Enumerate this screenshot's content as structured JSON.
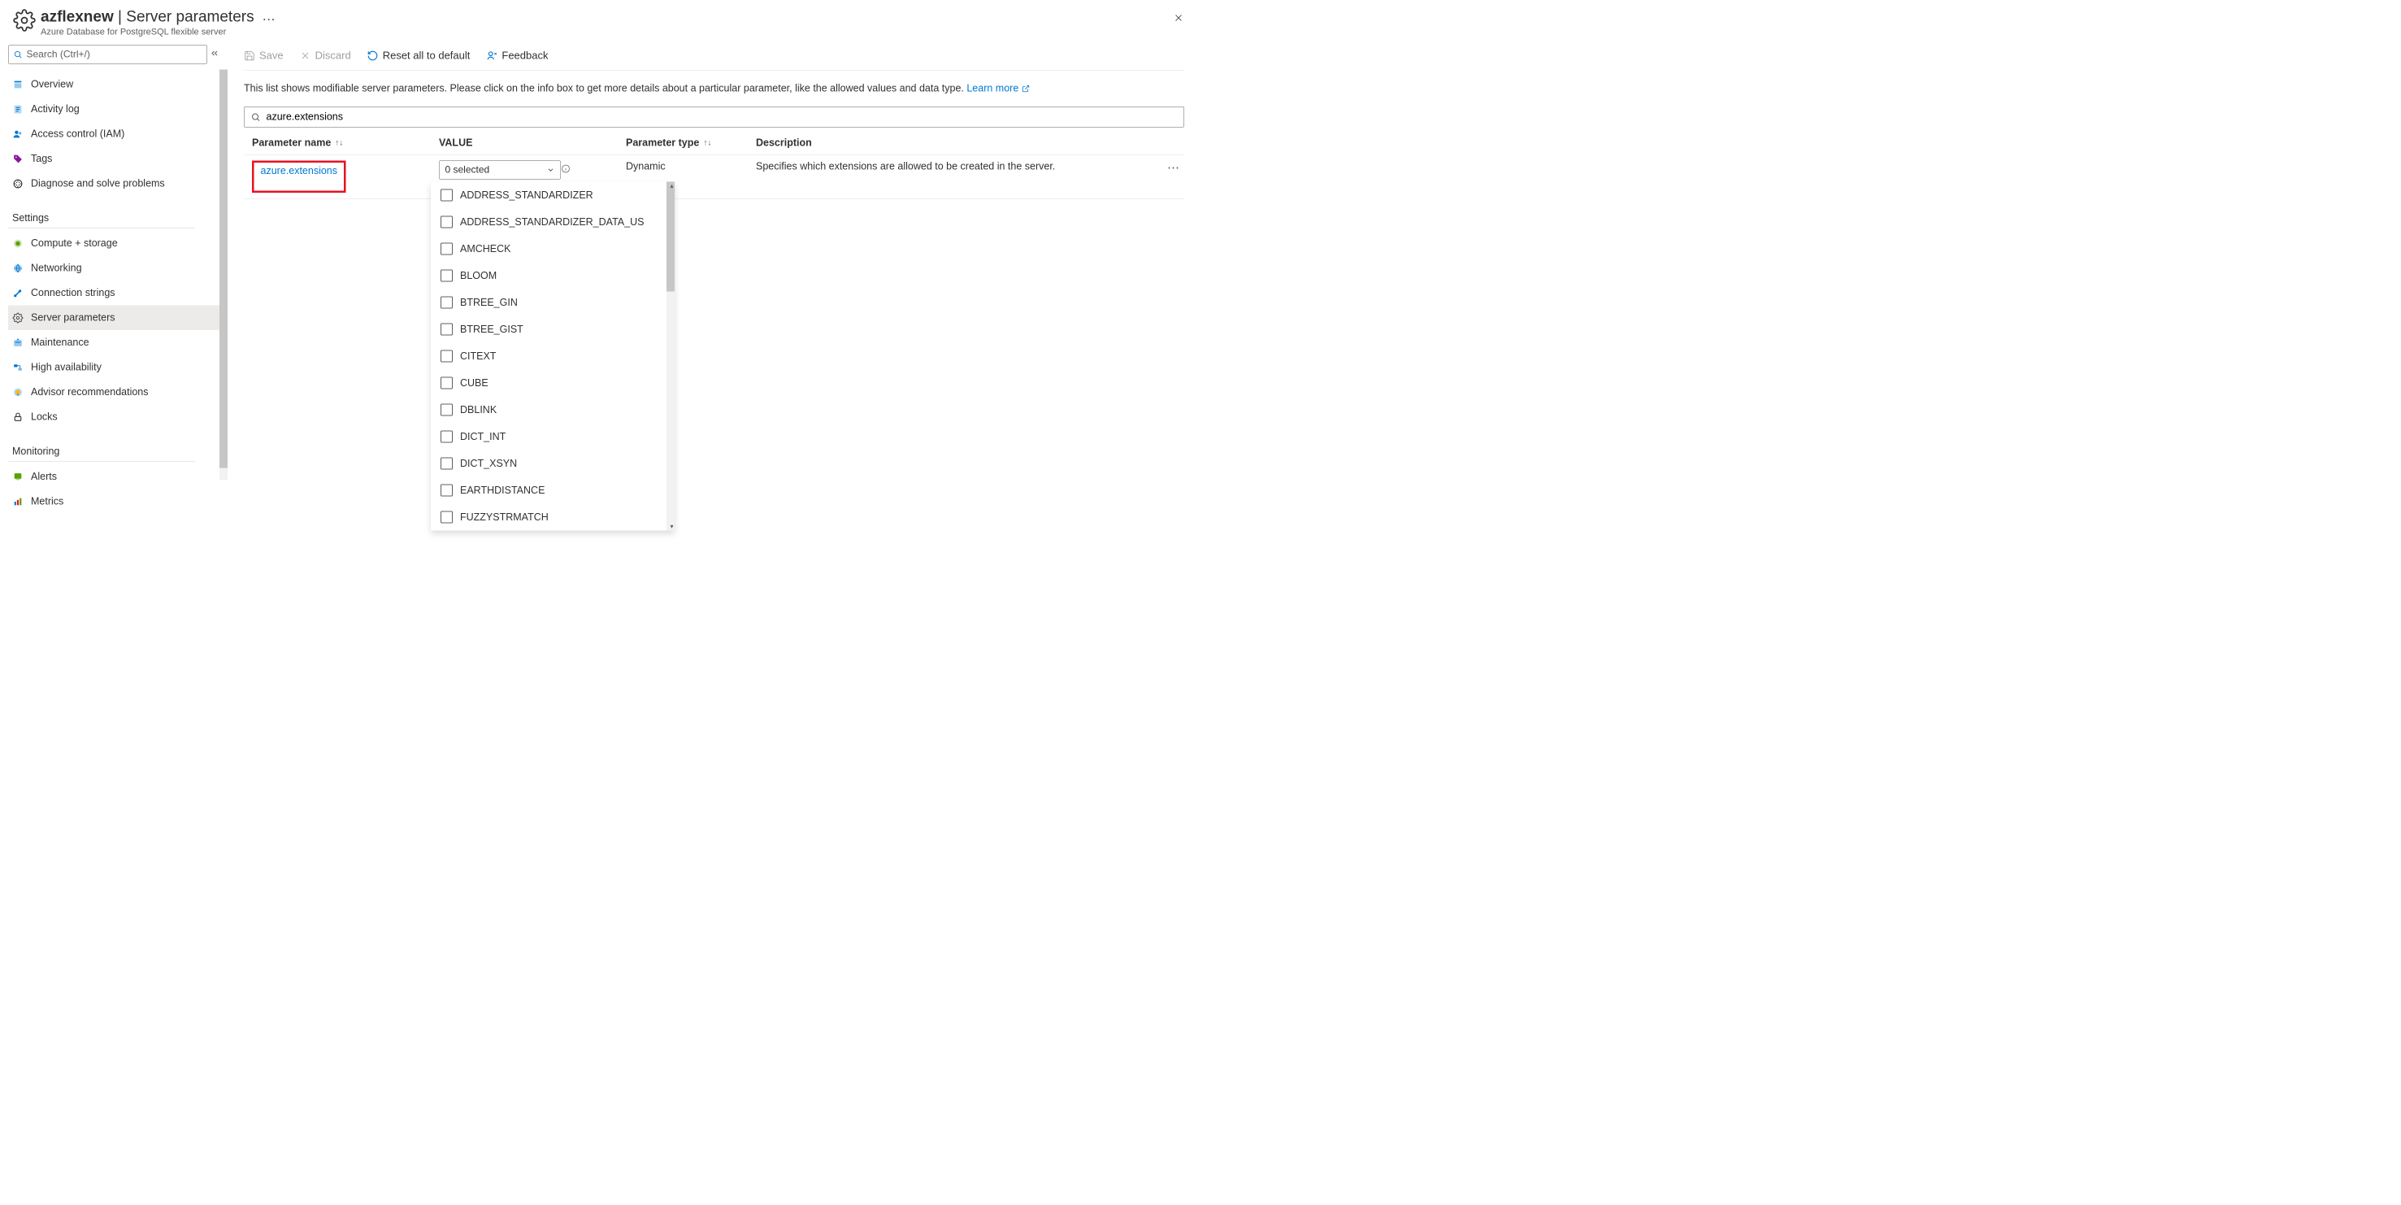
{
  "header": {
    "resource_name": "azflexnew",
    "page_title": "Server parameters",
    "subtitle": "Azure Database for PostgreSQL flexible server"
  },
  "sidebar": {
    "search_placeholder": "Search (Ctrl+/)",
    "items_top": [
      {
        "label": "Overview",
        "icon": "overview"
      },
      {
        "label": "Activity log",
        "icon": "activitylog"
      },
      {
        "label": "Access control (IAM)",
        "icon": "iam"
      },
      {
        "label": "Tags",
        "icon": "tags"
      },
      {
        "label": "Diagnose and solve problems",
        "icon": "diagnose"
      }
    ],
    "section_settings": "Settings",
    "items_settings": [
      {
        "label": "Compute + storage",
        "icon": "compute"
      },
      {
        "label": "Networking",
        "icon": "networking"
      },
      {
        "label": "Connection strings",
        "icon": "connstr"
      },
      {
        "label": "Server parameters",
        "icon": "gear",
        "selected": true
      },
      {
        "label": "Maintenance",
        "icon": "maintenance"
      },
      {
        "label": "High availability",
        "icon": "ha"
      },
      {
        "label": "Advisor recommendations",
        "icon": "advisor"
      },
      {
        "label": "Locks",
        "icon": "locks"
      }
    ],
    "section_monitoring": "Monitoring",
    "items_monitoring": [
      {
        "label": "Alerts",
        "icon": "alerts"
      },
      {
        "label": "Metrics",
        "icon": "metrics"
      }
    ]
  },
  "toolbar": {
    "save": "Save",
    "discard": "Discard",
    "reset": "Reset all to default",
    "feedback": "Feedback"
  },
  "intro": {
    "text": "This list shows modifiable server parameters. Please click on the info box to get more details about a particular parameter, like the allowed values and data type.",
    "learn_more": "Learn more"
  },
  "filter_value": "azure.extensions",
  "table": {
    "headers": {
      "name": "Parameter name",
      "value": "VALUE",
      "ptype": "Parameter type",
      "desc": "Description"
    },
    "row": {
      "name": "azure.extensions",
      "value_selected": "0 selected",
      "ptype": "Dynamic",
      "desc": "Specifies which extensions are allowed to be created in the server."
    }
  },
  "dropdown_items": [
    "ADDRESS_STANDARDIZER",
    "ADDRESS_STANDARDIZER_DATA_US",
    "AMCHECK",
    "BLOOM",
    "BTREE_GIN",
    "BTREE_GIST",
    "CITEXT",
    "CUBE",
    "DBLINK",
    "DICT_INT",
    "DICT_XSYN",
    "EARTHDISTANCE",
    "FUZZYSTRMATCH"
  ]
}
